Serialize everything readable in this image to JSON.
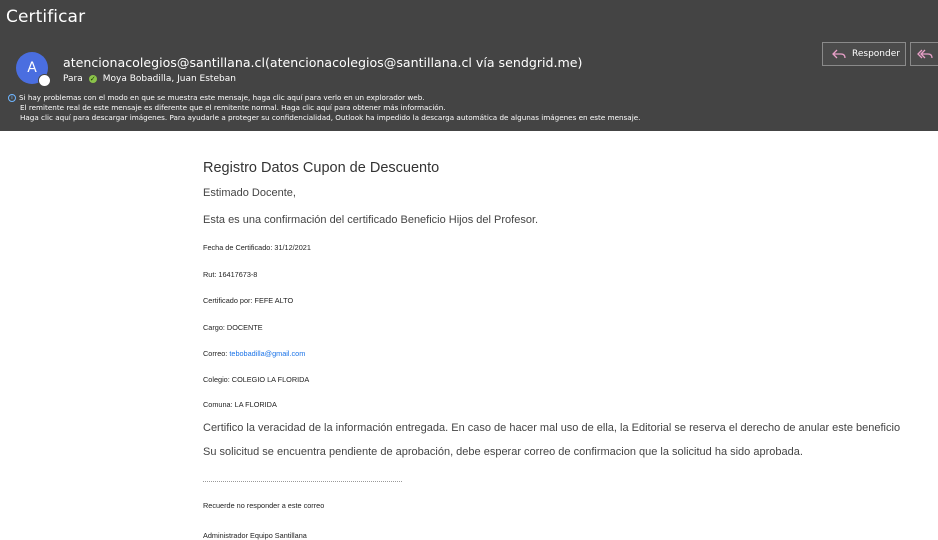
{
  "message": {
    "subject": "Certificar",
    "avatar_letter": "A",
    "from": "atencionacolegios@santillana.cl(atencionacolegios@santillana.cl vía sendgrid.me)",
    "to_label": "Para",
    "to_name": "Moya Bobadilla, Juan Esteban"
  },
  "actions": {
    "reply_label": "Responder"
  },
  "infobar": {
    "line1": "Si hay problemas con el modo en que se muestra este mensaje, haga clic aquí para verlo en un explorador web.",
    "line2": "El remitente real de este mensaje es diferente que el remitente normal. Haga clic aquí para obtener más información.",
    "line3": "Haga clic aquí para descargar imágenes. Para ayudarle a proteger su confidencialidad, Outlook ha impedido la descarga automática de algunas imágenes en este mensaje."
  },
  "body": {
    "heading": "Registro Datos Cupon de Descuento",
    "greeting": "Estimado Docente,",
    "intro": "Esta es una confirmación del certificado Beneficio Hijos del Profesor.",
    "fecha": "Fecha de Certificado: 31/12/2021",
    "rut": "Rut: 16417673-8",
    "certificado_por": "Certificado por: FEFE ALTO",
    "cargo": "Cargo: DOCENTE",
    "correo_label": "Correo: ",
    "correo_email": "tebobadilla@gmail.com",
    "colegio": "Colegio: COLEGIO LA FLORIDA",
    "comuna": "Comuna: LA FLORIDA",
    "certifico": "Certifico la veracidad de la información entregada. En caso de hacer mal uso de ella, la Editorial se reserva el derecho de anular este beneficio",
    "pendiente": "Su solicitud se encuentra pendiente de aprobación, debe esperar correo de confirmacion que la solicitud ha sido aprobada.",
    "recuerde": "Recuerde no responder a este correo",
    "firma": "Administrador Equipo Santillana"
  }
}
